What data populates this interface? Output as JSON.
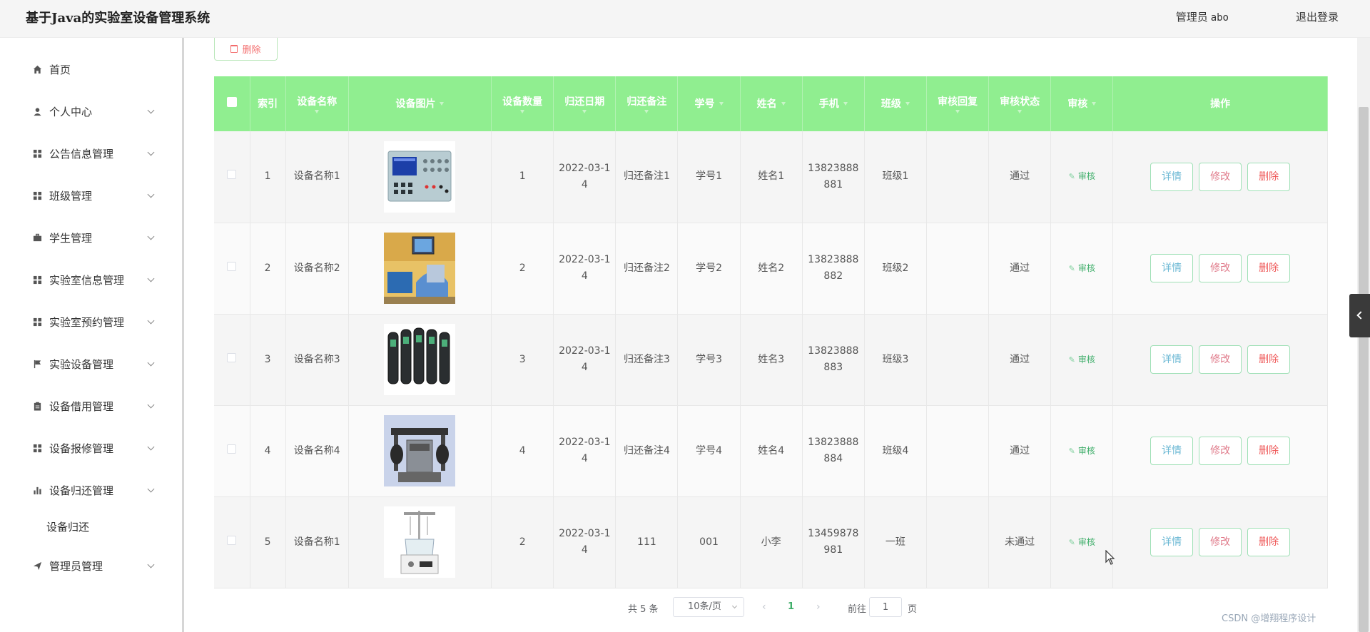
{
  "header": {
    "title": "基于Java的实验室设备管理系统",
    "admin_role": "管理员",
    "admin_name": "abo",
    "logout": "退出登录"
  },
  "sidebar": {
    "items": [
      {
        "label": "首页",
        "icon": "home-icon"
      },
      {
        "label": "个人中心",
        "icon": "user-icon"
      },
      {
        "label": "公告信息管理",
        "icon": "grid-icon"
      },
      {
        "label": "班级管理",
        "icon": "grid-icon"
      },
      {
        "label": "学生管理",
        "icon": "briefcase-icon"
      },
      {
        "label": "实验室信息管理",
        "icon": "grid-icon"
      },
      {
        "label": "实验室预约管理",
        "icon": "grid-icon"
      },
      {
        "label": "实验设备管理",
        "icon": "flag-icon"
      },
      {
        "label": "设备借用管理",
        "icon": "clipboard-icon"
      },
      {
        "label": "设备报修管理",
        "icon": "grid-icon"
      },
      {
        "label": "设备归还管理",
        "icon": "bar-chart-icon"
      },
      {
        "label": "管理员管理",
        "icon": "send-icon"
      }
    ],
    "submenu": {
      "label": "设备归还"
    }
  },
  "toolbar": {
    "delete_label": "删除"
  },
  "table": {
    "headers": {
      "index": "索引",
      "device_name": "设备名称",
      "device_image": "设备图片",
      "device_count": "设备数量",
      "return_date": "归还日期",
      "return_note": "归还备注",
      "student_id": "学号",
      "name": "姓名",
      "phone": "手机",
      "class": "班级",
      "audit_reply": "审核回复",
      "audit_status": "审核状态",
      "audit": "审核",
      "actions": "操作"
    },
    "rows": [
      {
        "index": "1",
        "device_name": "设备名称1",
        "count": "1",
        "date": "2022-03-14",
        "note": "归还备注1",
        "student_id": "学号1",
        "name": "姓名1",
        "phone": "13823888881",
        "class": "班级1",
        "reply": "",
        "status": "通过",
        "image": "instrument-panel"
      },
      {
        "index": "2",
        "device_name": "设备名称2",
        "count": "2",
        "date": "2022-03-14",
        "note": "归还备注2",
        "student_id": "学号2",
        "name": "姓名2",
        "phone": "13823888882",
        "class": "班级2",
        "reply": "",
        "status": "通过",
        "image": "lab-station"
      },
      {
        "index": "3",
        "device_name": "设备名称3",
        "count": "3",
        "date": "2022-03-14",
        "note": "归还备注3",
        "student_id": "学号3",
        "name": "姓名3",
        "phone": "13823888883",
        "class": "班级3",
        "reply": "",
        "status": "通过",
        "image": "handheld-meters"
      },
      {
        "index": "4",
        "device_name": "设备名称4",
        "count": "4",
        "date": "2022-03-14",
        "note": "归还备注4",
        "student_id": "学号4",
        "name": "姓名4",
        "phone": "13823888884",
        "class": "班级4",
        "reply": "",
        "status": "通过",
        "image": "test-rig"
      },
      {
        "index": "5",
        "device_name": "设备名称1",
        "count": "2",
        "date": "2022-03-14",
        "note": "111",
        "student_id": "001",
        "name": "小李",
        "phone": "13459878981",
        "class": "一班",
        "reply": "",
        "status": "未通过",
        "image": "glass-reactor"
      }
    ],
    "audit_link": "审核",
    "actions": {
      "detail": "详情",
      "edit": "修改",
      "delete": "删除"
    }
  },
  "pagination": {
    "total": "共 5 条",
    "page_size": "10条/页",
    "current_page": "1",
    "goto_label": "前往",
    "goto_value": "1",
    "page_unit": "页"
  },
  "watermark": "CSDN @增翔程序设计",
  "colors": {
    "header_green": "#90ee90",
    "accent_green": "#3fae6a",
    "danger": "#f36c6c"
  }
}
